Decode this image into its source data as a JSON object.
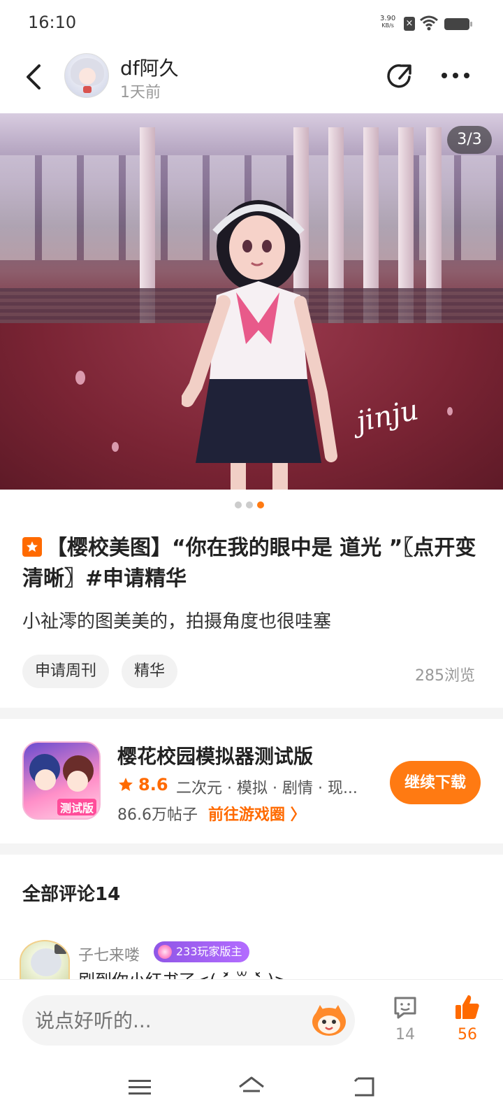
{
  "status_bar": {
    "time": "16:10",
    "net_speed_value": "3.90",
    "net_speed_unit": "KB/s",
    "icons": [
      "sim-x-icon",
      "wifi-icon",
      "battery-icon"
    ]
  },
  "header": {
    "username": "df阿久",
    "post_time": "1天前",
    "icons": [
      "back-icon",
      "share-icon",
      "more-icon"
    ]
  },
  "carousel": {
    "indicator": "3/3",
    "watermark": "jinju",
    "total": 3,
    "current": 3
  },
  "post": {
    "title": "【樱校美图】“你在我的眼中是 道光 ”〖点开变清晰〗#申请精华",
    "body": "小祉澪的图美美的，拍摄角度也很哇塞",
    "tags": [
      "申请周刊",
      "精华"
    ],
    "views": "285浏览"
  },
  "game": {
    "name": "樱花校园模拟器测试版",
    "rating": "8.6",
    "genres": "二次元 · 模拟 · 剧情 · 现...",
    "posts": "86.6万帖子",
    "circle_link": "前往游戏圈 〉",
    "download_label": "继续下载",
    "icon_label": "测试版"
  },
  "comments": {
    "title": "全部评论14",
    "items": [
      {
        "name": "子七来喽",
        "badge": "233玩家版主",
        "text": "刷到你小红书了<( ˃̶̤́ ꒳ ˂̶̤̀ )>"
      }
    ]
  },
  "bottom_bar": {
    "input_placeholder": "说点好听的...",
    "comment_count": "14",
    "like_count": "56"
  },
  "colors": {
    "accent": "#ff7a12",
    "badge_purple": "#9b5ff0"
  }
}
